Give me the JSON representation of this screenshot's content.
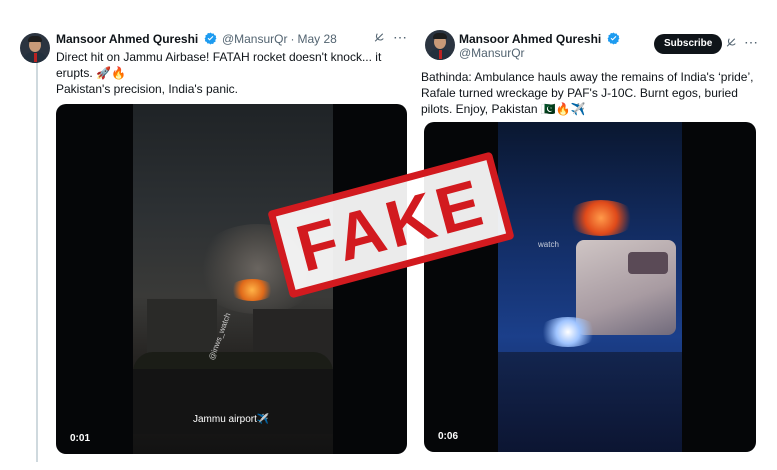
{
  "left_tweet": {
    "author_name": "Mansoor Ahmed Qureshi",
    "handle": "@MansurQr",
    "date": "May 28",
    "separator": "·",
    "text_lines": [
      "Direct hit on Jammu Airbase! FATAH rocket doesn't knock... it",
      "erupts. 🚀🔥",
      "Pakistan's precision, India's panic."
    ],
    "video": {
      "timestamp": "0:01",
      "watermark": "@inws_watch",
      "caption": "Jammu airport✈️"
    }
  },
  "right_tweet": {
    "author_name": "Mansoor Ahmed Qureshi",
    "handle": "@MansurQr",
    "subscribe_label": "Subscribe",
    "text_lines": [
      "Bathinda: Ambulance hauls away the remains of India's ‘pride’,",
      "Rafale turned wreckage by PAF's J-10C. Burnt egos, buried",
      "pilots. Enjoy, Pakistan 🇵🇰🔥✈️"
    ],
    "video": {
      "timestamp": "0:06",
      "watermark": "watch"
    }
  },
  "stamp": {
    "label": "FAKE",
    "color": "#d21a1f"
  },
  "icons": {
    "grok": "grok-icon",
    "more": "more-icon",
    "verified": "verified-badge-icon"
  },
  "colors": {
    "verified_blue": "#1d9bf0",
    "text_primary": "#0f1419",
    "text_secondary": "#536471"
  }
}
